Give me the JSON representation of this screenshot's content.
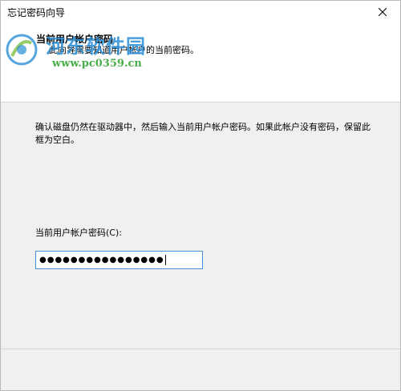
{
  "window": {
    "title": "忘记密码向导"
  },
  "header": {
    "title": "当前用户帐户密码",
    "subtitle": "此向导需要知道用户帐户的当前密码。"
  },
  "watermark": {
    "brand": "河东软件园",
    "url": "www.pc0359.cn"
  },
  "body": {
    "instructions": "确认磁盘仍然在驱动器中，然后输入当前用户帐户密码。如果此帐户没有密码，保留此框为空白。"
  },
  "password_field": {
    "label": "当前用户帐户密码(C):",
    "masked_value": "●●●●●●●●●●●●●●●●"
  },
  "icons": {
    "close": "close-icon",
    "logo": "hedong-logo-icon"
  },
  "colors": {
    "accent": "#4a90d9",
    "watermark_blue": "#2a8fd6",
    "watermark_green": "#2aa12a"
  }
}
